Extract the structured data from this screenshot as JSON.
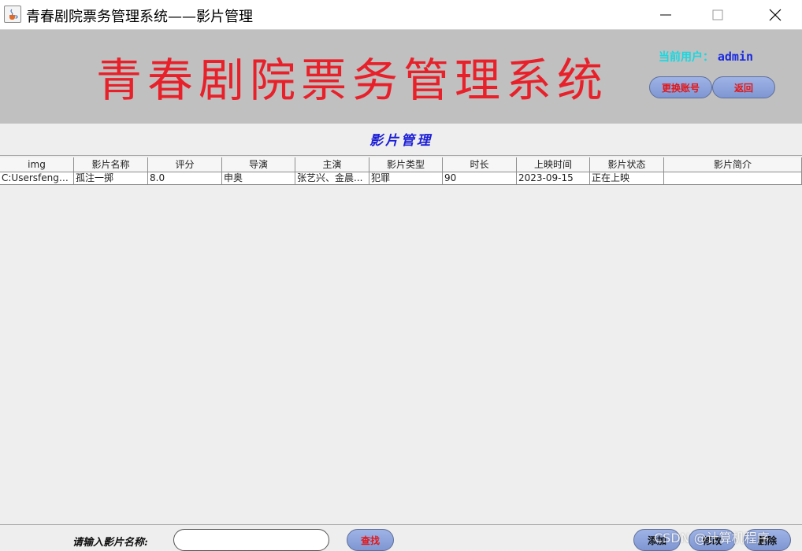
{
  "window": {
    "title": "青春剧院票务管理系统——影片管理",
    "icon": "java-cup-icon"
  },
  "header": {
    "banner_title": "青春剧院票务管理系统",
    "user_label": "当前用户：",
    "user_name": "admin",
    "switch_account_label": "更换账号",
    "back_label": "返回"
  },
  "page_title": "影片管理",
  "table": {
    "columns": [
      "img",
      "影片名称",
      "评分",
      "导演",
      "主演",
      "影片类型",
      "时长",
      "上映时间",
      "影片状态",
      "影片简介"
    ],
    "rows": [
      [
        "C:Usersfengh...",
        "孤注一掷",
        "8.0",
        "申奥",
        "张艺兴、金晨...",
        "犯罪",
        "90",
        "2023-09-15",
        "正在上映",
        ""
      ]
    ]
  },
  "search": {
    "label": "请输入影片名称:",
    "value": "",
    "button_label": "查找"
  },
  "actions": {
    "add_label": "添加",
    "edit_label": "修改",
    "delete_label": "删除"
  },
  "watermark": "CSDN @计算机程序",
  "colors": {
    "banner_bg": "#c0c0c0",
    "banner_title": "#e8202a",
    "user_label": "#18d8e0",
    "user_name": "#1a2ae0",
    "page_title": "#1c1ed6",
    "button_text": "#e31717",
    "button_bg": "#8da3dc"
  }
}
